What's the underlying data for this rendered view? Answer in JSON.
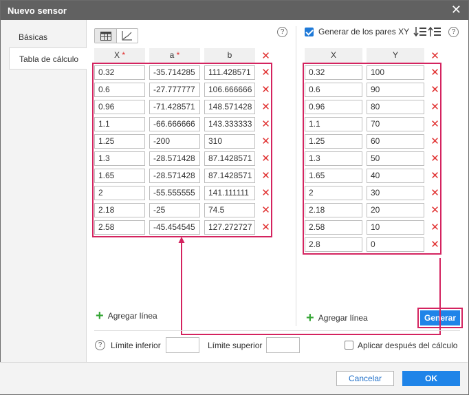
{
  "window": {
    "title": "Nuevo sensor"
  },
  "sidebar": {
    "items": [
      {
        "label": "Básicas"
      },
      {
        "label": "Tabla de cálculo"
      }
    ]
  },
  "left_table": {
    "headers": {
      "x": "X",
      "a": "a",
      "b": "b",
      "required_mark": "*"
    },
    "rows": [
      {
        "x": "0.32",
        "a": "-35.714285",
        "b": "111.428571"
      },
      {
        "x": "0.6",
        "a": "-27.777777",
        "b": "106.666666"
      },
      {
        "x": "0.96",
        "a": "-71.428571",
        "b": "148.571428"
      },
      {
        "x": "1.1",
        "a": "-66.666666",
        "b": "143.333333"
      },
      {
        "x": "1.25",
        "a": "-200",
        "b": "310"
      },
      {
        "x": "1.3",
        "a": "-28.571428",
        "b": "87.1428571"
      },
      {
        "x": "1.65",
        "a": "-28.571428",
        "b": "87.1428571"
      },
      {
        "x": "2",
        "a": "-55.555555",
        "b": "141.111111"
      },
      {
        "x": "2.18",
        "a": "-25",
        "b": "74.5"
      },
      {
        "x": "2.58",
        "a": "-45.454545",
        "b": "127.272727"
      }
    ],
    "add_line_label": "Agregar línea"
  },
  "right_table": {
    "generate_pairs_label": "Generar de los pares XY",
    "generate_pairs_checked": true,
    "headers": {
      "x": "X",
      "y": "Y"
    },
    "rows": [
      {
        "x": "0.32",
        "y": "100"
      },
      {
        "x": "0.6",
        "y": "90"
      },
      {
        "x": "0.96",
        "y": "80"
      },
      {
        "x": "1.1",
        "y": "70"
      },
      {
        "x": "1.25",
        "y": "60"
      },
      {
        "x": "1.3",
        "y": "50"
      },
      {
        "x": "1.65",
        "y": "40"
      },
      {
        "x": "2",
        "y": "30"
      },
      {
        "x": "2.18",
        "y": "20"
      },
      {
        "x": "2.58",
        "y": "10"
      },
      {
        "x": "2.8",
        "y": "0"
      }
    ],
    "add_line_label": "Agregar línea",
    "generate_button": "Generar"
  },
  "bounds": {
    "lower_label": "Límite inferior",
    "lower_value": "",
    "upper_label": "Límite superior",
    "upper_value": "",
    "apply_after_label": "Aplicar después del cálculo",
    "apply_after_checked": false
  },
  "footer": {
    "cancel_label": "Cancelar",
    "ok_label": "OK"
  },
  "colors": {
    "accent": "#1f84e8",
    "highlight": "#d4235f",
    "delete": "#e03030",
    "add": "#36a636",
    "titlebar": "#616161"
  },
  "icons": {
    "close": "close-icon",
    "help": "help-icon",
    "delete": "delete-row-icon",
    "add": "plus-icon",
    "table_view": "table-icon",
    "chart_view": "chart-icon"
  }
}
